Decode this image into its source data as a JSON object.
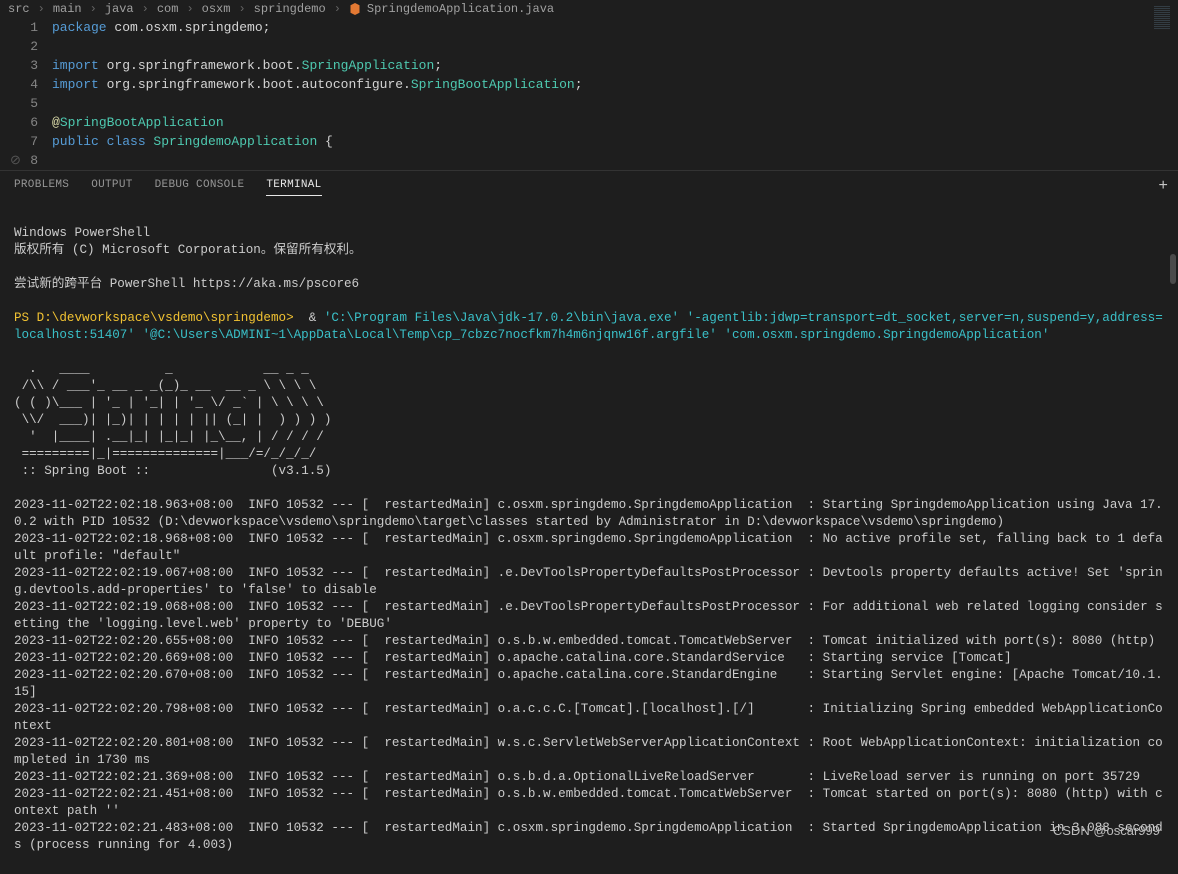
{
  "breadcrumb": [
    "src",
    "main",
    "java",
    "com",
    "osxm",
    "springdemo",
    "SpringdemoApplication.java"
  ],
  "code": {
    "l1": {
      "kw": "package",
      "rest": " com.osxm.springdemo;"
    },
    "l2": "",
    "l3": {
      "kw": "import",
      "rest": " org.springframework.boot.",
      "cls": "SpringApplication",
      "end": ";"
    },
    "l4": {
      "kw": "import",
      "rest": " org.springframework.boot.autoconfigure.",
      "cls": "SpringBootApplication",
      "end": ";"
    },
    "l5": "",
    "l6": {
      "at": "@",
      "ann": "SpringBootApplication"
    },
    "l7": {
      "kw": "public class ",
      "cls": "SpringdemoApplication",
      "end": " {"
    },
    "l8": ""
  },
  "gutter": [
    "1",
    "2",
    "3",
    "4",
    "5",
    "6",
    "7",
    "8"
  ],
  "panel": {
    "problems": "PROBLEMS",
    "output": "OUTPUT",
    "debug": "DEBUG CONSOLE",
    "terminal": "TERMINAL"
  },
  "terminal": {
    "psHeader": "Windows PowerShell",
    "copyright": "版权所有 (C) Microsoft Corporation。保留所有权利。",
    "tryNew": "尝试新的跨平台 PowerShell https://aka.ms/pscore6",
    "promptPrefix": "PS D:\\devworkspace\\vsdemo\\springdemo>  ",
    "amp": "& ",
    "cmd": "'C:\\Program Files\\Java\\jdk-17.0.2\\bin\\java.exe' '-agentlib:jdwp=transport=dt_socket,server=n,suspend=y,address=localhost:51407' '@C:\\Users\\ADMINI~1\\AppData\\Local\\Temp\\cp_7cbzc7nocfkm7h4m6njqnw16f.argfile' 'com.osxm.springdemo.SpringdemoApplication'",
    "banner": "  .   ____          _            __ _ _\n /\\\\ / ___'_ __ _ _(_)_ __  __ _ \\ \\ \\ \\\n( ( )\\___ | '_ | '_| | '_ \\/ _` | \\ \\ \\ \\\n \\\\/  ___)| |_)| | | | | || (_| |  ) ) ) )\n  '  |____| .__|_| |_|_| |_\\__, | / / / /\n =========|_|==============|___/=/_/_/_/\n :: Spring Boot ::                (v3.1.5)",
    "logs": [
      "2023-11-02T22:02:18.963+08:00  INFO 10532 --- [  restartedMain] c.osxm.springdemo.SpringdemoApplication  : Starting SpringdemoApplication using Java 17.0.2 with PID 10532 (D:\\devworkspace\\vsdemo\\springdemo\\target\\classes started by Administrator in D:\\devworkspace\\vsdemo\\springdemo)",
      "2023-11-02T22:02:18.968+08:00  INFO 10532 --- [  restartedMain] c.osxm.springdemo.SpringdemoApplication  : No active profile set, falling back to 1 default profile: \"default\"",
      "2023-11-02T22:02:19.067+08:00  INFO 10532 --- [  restartedMain] .e.DevToolsPropertyDefaultsPostProcessor : Devtools property defaults active! Set 'spring.devtools.add-properties' to 'false' to disable",
      "2023-11-02T22:02:19.068+08:00  INFO 10532 --- [  restartedMain] .e.DevToolsPropertyDefaultsPostProcessor : For additional web related logging consider setting the 'logging.level.web' property to 'DEBUG'",
      "2023-11-02T22:02:20.655+08:00  INFO 10532 --- [  restartedMain] o.s.b.w.embedded.tomcat.TomcatWebServer  : Tomcat initialized with port(s): 8080 (http)",
      "2023-11-02T22:02:20.669+08:00  INFO 10532 --- [  restartedMain] o.apache.catalina.core.StandardService   : Starting service [Tomcat]",
      "2023-11-02T22:02:20.670+08:00  INFO 10532 --- [  restartedMain] o.apache.catalina.core.StandardEngine    : Starting Servlet engine: [Apache Tomcat/10.1.15]",
      "2023-11-02T22:02:20.798+08:00  INFO 10532 --- [  restartedMain] o.a.c.c.C.[Tomcat].[localhost].[/]       : Initializing Spring embedded WebApplicationContext",
      "2023-11-02T22:02:20.801+08:00  INFO 10532 --- [  restartedMain] w.s.c.ServletWebServerApplicationContext : Root WebApplicationContext: initialization completed in 1730 ms",
      "2023-11-02T22:02:21.369+08:00  INFO 10532 --- [  restartedMain] o.s.b.d.a.OptionalLiveReloadServer       : LiveReload server is running on port 35729",
      "2023-11-02T22:02:21.451+08:00  INFO 10532 --- [  restartedMain] o.s.b.w.embedded.tomcat.TomcatWebServer  : Tomcat started on port(s): 8080 (http) with context path ''",
      "2023-11-02T22:02:21.483+08:00  INFO 10532 --- [  restartedMain] c.osxm.springdemo.SpringdemoApplication  : Started SpringdemoApplication in 3.088 seconds (process running for 4.003)"
    ]
  },
  "watermark": "CSDN @oscar999"
}
